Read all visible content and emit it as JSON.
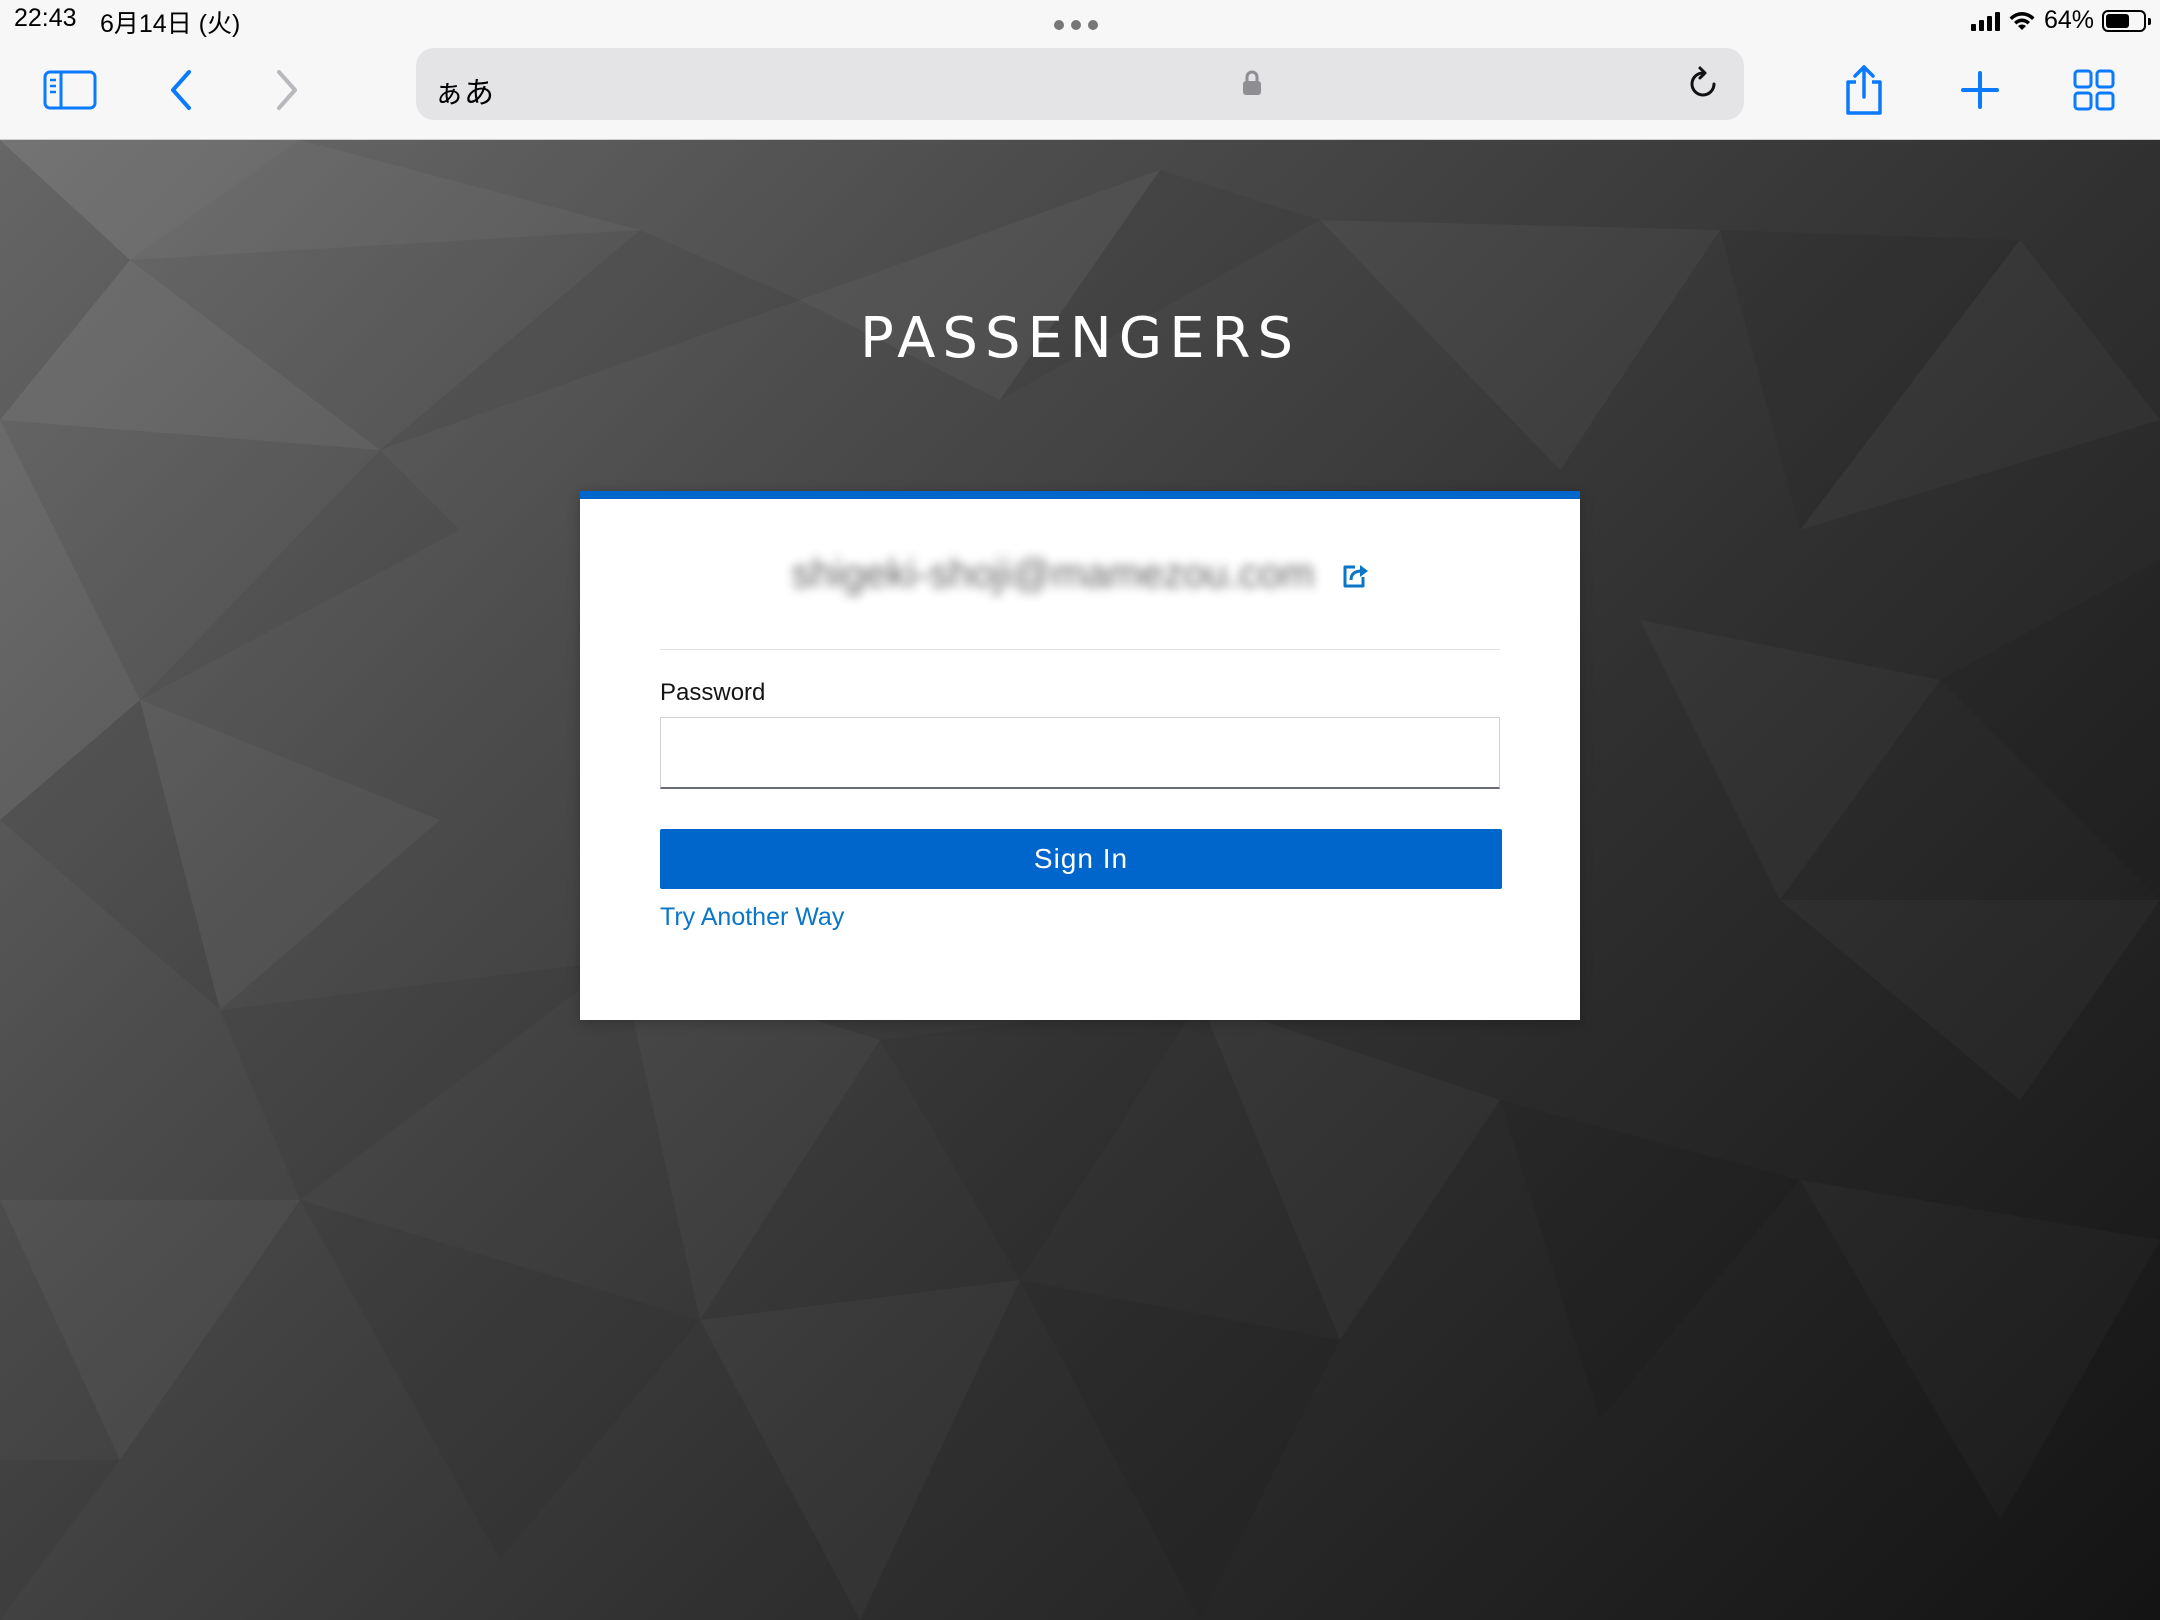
{
  "status_bar": {
    "time": "22:43",
    "date": "6月14日 (火)",
    "battery": "64%",
    "battery_level": 0.64
  },
  "toolbar": {
    "address_text": "ぁあ",
    "icons": [
      "sidebar-icon",
      "back-icon",
      "forward-icon",
      "lock-icon",
      "reload-icon",
      "share-icon",
      "plus-icon",
      "tabs-grid-icon"
    ]
  },
  "login": {
    "brand": "PASSENGERS",
    "username": "shigeki-shoji@mamezou.com",
    "password_label": "Password",
    "password_value": "",
    "sign_in_label": "Sign In",
    "try_another_label": "Try Another Way"
  },
  "colors": {
    "accent": "#0066cc",
    "link": "#0a76c9",
    "ios_blue": "#0a7aff"
  }
}
